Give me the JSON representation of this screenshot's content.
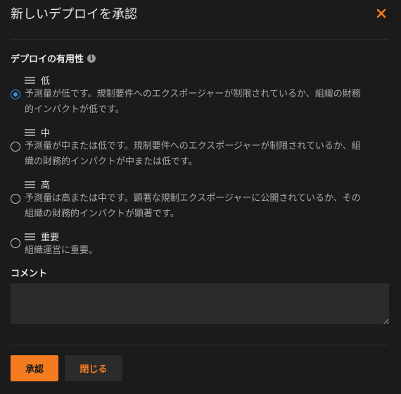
{
  "dialog": {
    "title": "新しいデプロイを承認",
    "close_icon": "close-icon",
    "accent_color": "#f47b20"
  },
  "availability": {
    "label": "デプロイの有用性",
    "info_icon": "i",
    "options": [
      {
        "label": "低",
        "description_line1": "予測量が低です。規制要件へのエクスポージャーが制限されているか、組織の財務",
        "description_line2": "的インパクトが低です。",
        "checked": true
      },
      {
        "label": "中",
        "description_line1": "予測量が中または低です。規制要件へのエクスポージャーが制限されているか、組",
        "description_line2": "織の財務的インパクトが中または低です。",
        "checked": false
      },
      {
        "label": "高",
        "description_line1": "予測量は高または中です。顕著な規制エクスポージャーに公開されているか、その",
        "description_line2": "組織の財務的インパクトが顕著です。",
        "checked": false
      },
      {
        "label": "重要",
        "description_line1": "組織運営に重要。",
        "description_line2": "",
        "checked": false
      }
    ]
  },
  "comment": {
    "label": "コメント",
    "value": "",
    "placeholder": ""
  },
  "buttons": {
    "approve_label": "承認",
    "close_label": "閉じる"
  }
}
